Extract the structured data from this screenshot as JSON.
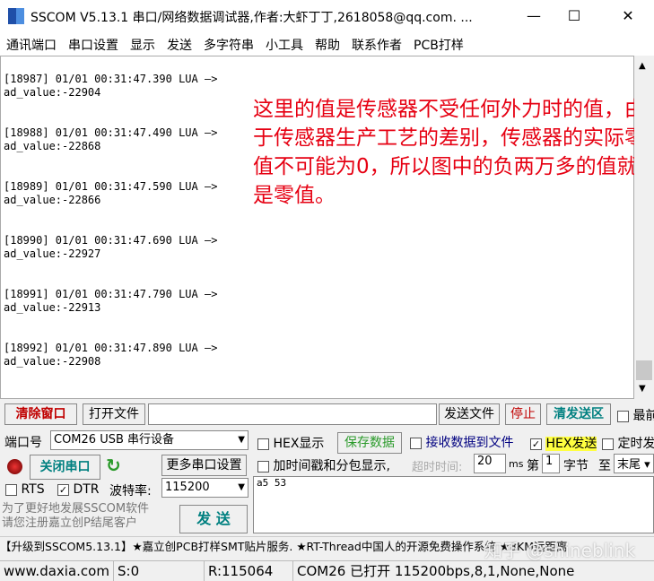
{
  "title": "SSCOM V5.13.1 串口/网络数据调试器,作者:大虾丁丁,2618058@qq.com. ...",
  "window": {
    "minimize": "—",
    "maximize": "☐",
    "close": "✕"
  },
  "menu": [
    "通讯端口",
    "串口设置",
    "显示",
    "发送",
    "多字符串",
    "小工具",
    "帮助",
    "联系作者",
    "PCB打样"
  ],
  "log": [
    {
      "header": "[18987] 01/01 00:31:47.390 LUA —>",
      "value": "ad_value:-22904"
    },
    {
      "header": "[18988] 01/01 00:31:47.490 LUA —>",
      "value": "ad_value:-22868"
    },
    {
      "header": "[18989] 01/01 00:31:47.590 LUA —>",
      "value": "ad_value:-22866"
    },
    {
      "header": "[18990] 01/01 00:31:47.690 LUA —>",
      "value": "ad_value:-22927"
    },
    {
      "header": "[18991] 01/01 00:31:47.790 LUA —>",
      "value": "ad_value:-22913"
    },
    {
      "header": "[18992] 01/01 00:31:47.890 LUA —>",
      "value": "ad_value:-22908"
    }
  ],
  "annotation": "这里的值是传感器不受任何外力时的值，由于传感器生产工艺的差别，传感器的实际零值不可能为0，所以图中的负两万多的值就是零值。",
  "toolbar": {
    "clear": "清除窗口",
    "open_file": "打开文件",
    "send_file": "发送文件",
    "stop": "停止",
    "clear_send": "清发送区",
    "last": "最前"
  },
  "port": {
    "label": "端口号",
    "value": "COM26 USB 串行设备",
    "close_port": "关闭串口",
    "more": "更多串口设置",
    "rts": "RTS",
    "dtr": "DTR",
    "baud_label": "波特率:",
    "baud": "115200"
  },
  "options": {
    "hex_display": "HEX显示",
    "save_data": "保存数据",
    "recv_to_file": "接收数据到文件",
    "hex_send": "HEX发送",
    "timed_send": "定时发",
    "timestamp": "加时间戳和分包显示,",
    "timeout_label": "超时时间:",
    "timeout": "20",
    "ms": "ms",
    "nth": "第",
    "byte_from": "1",
    "byte_label": "字节",
    "to": "至",
    "end": "末尾"
  },
  "send_text": "a5 53",
  "promo": "为了更好地发展SSCOM软件\n请您注册嘉立创P结尾客户",
  "send_button": "发 送",
  "marquee": "【升级到SSCOM5.13.1】★嘉立创PCB打样SMT贴片服务. ★RT-Thread中国人的开源免费操作系统 ★8KM远距离",
  "watermark": "知乎 @shineblink",
  "status": {
    "site": "www.daxia.com",
    "sent": "S:0",
    "recv": "R:115064",
    "port": "COM26 已打开  115200bps,8,1,None,None"
  }
}
